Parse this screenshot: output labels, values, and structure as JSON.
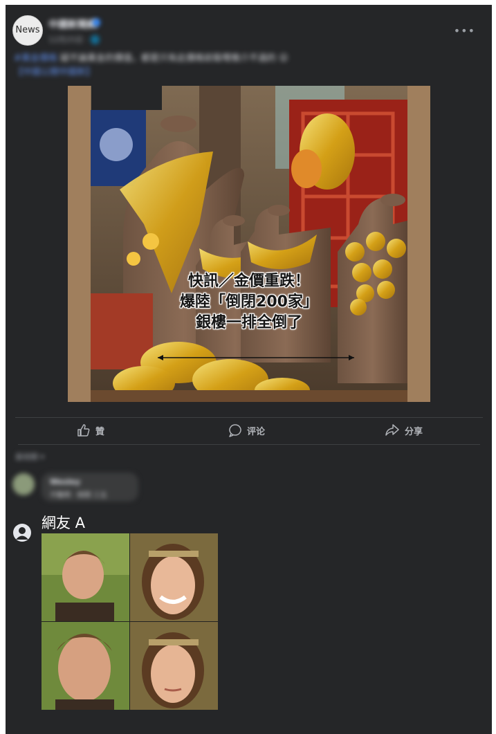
{
  "post": {
    "avatar_text": "News",
    "page_name": "中國新聞網",
    "meta": "12月25日 · 🌐",
    "caption_hashtag": "#黃金價格",
    "caption_text": " 疑不論黃金的價值，都是只有此價格前衛嚟推介不過的 😮",
    "caption_link": "【中國公開中國新】"
  },
  "image_overlay": {
    "line1": "快訊／金價重跌！",
    "line2": "爆陸「倒閉200家」",
    "line3": "銀樓一排全倒了"
  },
  "actions": {
    "like": "贊",
    "comment": "评论",
    "share": "分享"
  },
  "comments": {
    "sort_label": "最相關 ▾",
    "blurred_name": "Wesley",
    "blurred_text": "不難啊 · 倒閉 三五",
    "commenter_name": "網友 A"
  },
  "colors": {
    "background": "#252628",
    "text": "#e4e6eb",
    "muted": "#b0b3b8"
  },
  "icons": [
    "more-icon",
    "like-icon",
    "comment-icon",
    "share-icon",
    "user-icon"
  ]
}
